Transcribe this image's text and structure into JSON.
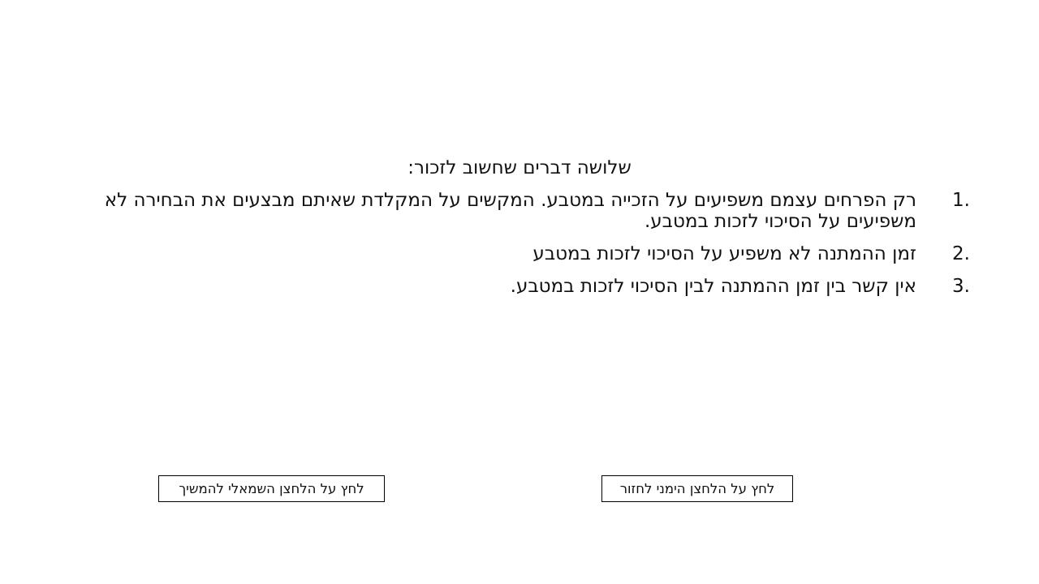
{
  "heading": "שלושה דברים שחשוב לזכור:",
  "items": [
    {
      "number": "1.",
      "text": "רק הפרחים עצמם משפיעים על הזכייה במטבע. המקשים על המקלדת שאיתם מבצעים את הבחירה לא משפיעים על הסיכוי לזכות במטבע."
    },
    {
      "number": "2.",
      "text": "זמן ההמתנה לא משפיע על הסיכוי לזכות במטבע"
    },
    {
      "number": "3.",
      "text": "אין קשר בין זמן ההמתנה לבין הסיכוי לזכות במטבע."
    }
  ],
  "buttons": {
    "continue_label": "לחץ על הלחצן השמאלי להמשיך",
    "back_label": "לחץ על הלחצן הימני לחזור"
  }
}
